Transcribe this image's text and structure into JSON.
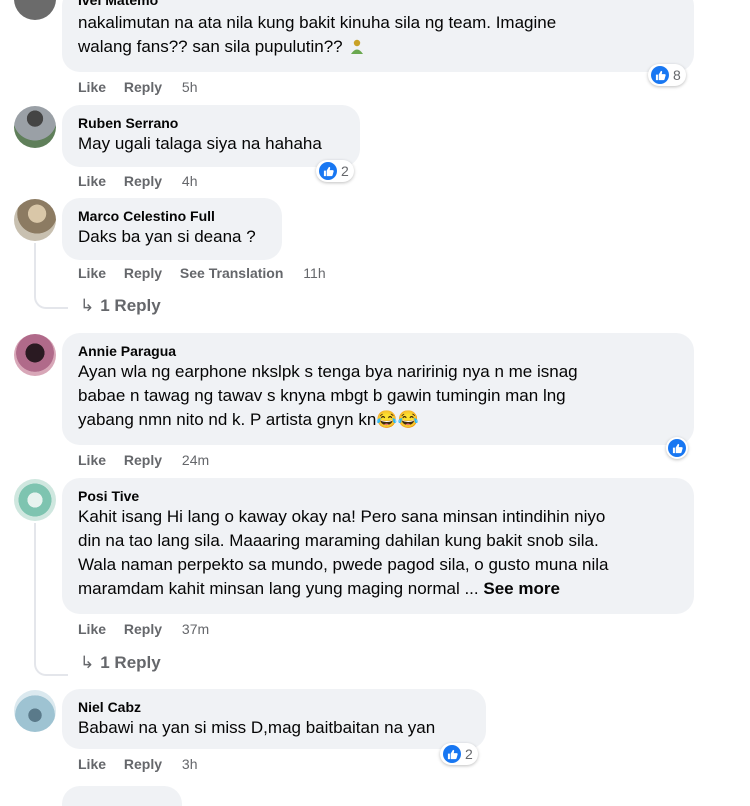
{
  "comments": [
    {
      "author": "Ivel Matemo",
      "text_lines": [
        "nakalimutan na ata nila kung bakit kinuha sila ng team. Imagine",
        "walang fans?? san sila pupulutin??"
      ],
      "actions": {
        "like": "Like",
        "reply": "Reply",
        "time": "5h"
      },
      "reactions": "8"
    },
    {
      "author": "Ruben Serrano",
      "text": "May ugali talaga siya na hahaha",
      "actions": {
        "like": "Like",
        "reply": "Reply",
        "time": "4h"
      },
      "reactions": "2"
    },
    {
      "author": "Marco Celestino Full",
      "text": "Daks ba yan si deana ?",
      "actions": {
        "like": "Like",
        "reply": "Reply",
        "translate": "See Translation",
        "time": "11h"
      },
      "replies": "1 Reply"
    },
    {
      "author": "Annie Paragua",
      "text_lines": [
        "Ayan wla ng earphone nkslpk s tenga bya naririnig nya n me isnag",
        "babae n tawag ng tawav s knyna mbgt b gawin tumingin man lng",
        "yabang nmn nito nd k. P artista gnyn kn😂😂"
      ],
      "actions": {
        "like": "Like",
        "reply": "Reply",
        "time": "24m"
      }
    },
    {
      "author": "Posi Tive",
      "text_lines": [
        "Kahit isang Hi lang o kaway okay na! Pero sana minsan intindihin niyo",
        "din na tao lang sila. Maaaring maraming dahilan kung bakit snob sila.",
        "Wala naman perpekto sa mundo, pwede pagod sila, o gusto muna nila",
        "maramdam kahit minsan lang yung maging normal ..."
      ],
      "see_more": "See more",
      "actions": {
        "like": "Like",
        "reply": "Reply",
        "time": "37m"
      },
      "replies": "1 Reply"
    },
    {
      "author": "Niel Cabz",
      "text": "Babawi na yan si miss D,mag baitbaitan na yan",
      "actions": {
        "like": "Like",
        "reply": "Reply",
        "time": "3h"
      },
      "reactions": "2"
    }
  ],
  "colors": {
    "bubble": "#f0f2f5",
    "action_text": "#65676b",
    "like_blue": "#1877f2"
  },
  "icons": {
    "like": "thumbs-up-icon",
    "reply_arrow": "reply-arrow-icon"
  }
}
